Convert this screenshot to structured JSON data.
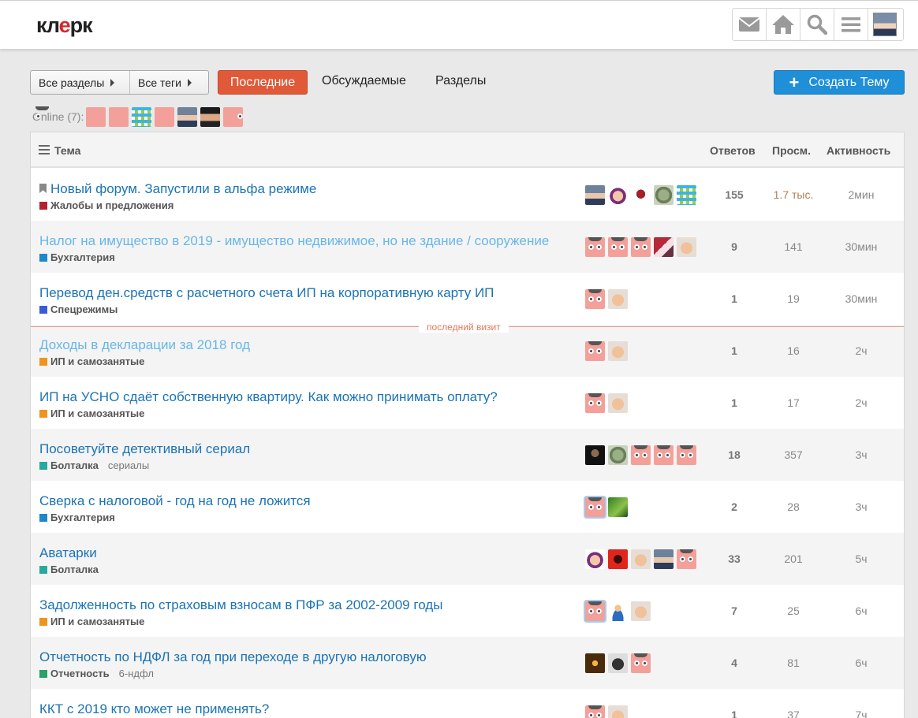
{
  "brand": {
    "logo_left": "кл",
    "logo_mid": "е",
    "logo_right": "рк"
  },
  "header_icons": [
    "mail-icon",
    "home-icon",
    "search-icon",
    "menu-icon",
    "user-avatar"
  ],
  "nav": {
    "all_sections": "Все разделы",
    "all_tags": "Все теги",
    "tab_latest": "Последние",
    "tab_discussed": "Обсуждаемые",
    "tab_sections": "Разделы",
    "create_topic": "Создать Тему"
  },
  "online": {
    "label": "Online (7):",
    "avatars": [
      "pig",
      "pig",
      "pix",
      "pig",
      "man",
      "dark",
      "pig"
    ]
  },
  "table": {
    "col_topic": "Тема",
    "col_replies": "Ответов",
    "col_views": "Просм.",
    "col_activity": "Активность",
    "last_visit_label": "последний визит"
  },
  "topics": [
    {
      "title": "Новый форум. Запустили в альфа режиме",
      "pinned": true,
      "visited": false,
      "category": "Жалобы и предложения",
      "cat_color": "#b3232f",
      "tag": "",
      "posters": [
        "man",
        "masha",
        "devil",
        "dollar",
        "pix"
      ],
      "replies": "155",
      "views": "1.7 тыс.",
      "activity": "2мин"
    },
    {
      "title": "Налог на имущество в 2019 - имущество недвижимое, но не здание / сооружение",
      "pinned": false,
      "visited": true,
      "category": "Бухгалтерия",
      "cat_color": "#1e88c8",
      "tag": "",
      "posters": [
        "pig",
        "pig",
        "pig",
        "anime",
        "cat"
      ],
      "replies": "9",
      "views": "141",
      "activity": "30мин"
    },
    {
      "title": "Перевод ден.средств с расчетного счета ИП на корпоративную карту ИП",
      "pinned": false,
      "visited": false,
      "category": "Спецрежимы",
      "cat_color": "#3a5bd9",
      "tag": "",
      "posters": [
        "pig",
        "cat"
      ],
      "replies": "1",
      "views": "19",
      "activity": "30мин"
    },
    {
      "title": "Доходы в декларации за 2018 год",
      "pinned": false,
      "visited": true,
      "category": "ИП и самозанятые",
      "cat_color": "#f0941e",
      "tag": "",
      "posters": [
        "pig",
        "cat"
      ],
      "replies": "1",
      "views": "16",
      "activity": "2ч"
    },
    {
      "title": "ИП на УСНО сдаёт собственную квартиру. Как можно принимать оплату?",
      "pinned": false,
      "visited": false,
      "category": "ИП и самозанятые",
      "cat_color": "#f0941e",
      "tag": "",
      "posters": [
        "pig",
        "cat"
      ],
      "replies": "1",
      "views": "17",
      "activity": "2ч"
    },
    {
      "title": "Посоветуйте детективный сериал",
      "pinned": false,
      "visited": false,
      "category": "Болталка",
      "cat_color": "#28a99e",
      "tag": "сериалы",
      "posters": [
        "black",
        "dollar",
        "pig",
        "pig",
        "pig"
      ],
      "replies": "18",
      "views": "357",
      "activity": "3ч"
    },
    {
      "title": "Сверка с налоговой - год на год не ложится",
      "pinned": false,
      "visited": false,
      "category": "Бухгалтерия",
      "cat_color": "#1e88c8",
      "tag": "",
      "posters": [
        "pig-hl",
        "leaf"
      ],
      "replies": "2",
      "views": "28",
      "activity": "3ч"
    },
    {
      "title": "Аватарки",
      "pinned": false,
      "visited": false,
      "category": "Болталка",
      "cat_color": "#28a99e",
      "tag": "",
      "posters": [
        "masha",
        "red",
        "cat",
        "man",
        "pig"
      ],
      "replies": "33",
      "views": "201",
      "activity": "5ч"
    },
    {
      "title": "Задолженность по страховым взносам в ПФР за 2002-2009 годы",
      "pinned": false,
      "visited": false,
      "category": "ИП и самозанятые",
      "cat_color": "#f0941e",
      "tag": "",
      "posters": [
        "pig-hl",
        "user",
        "cat"
      ],
      "replies": "7",
      "views": "25",
      "activity": "6ч"
    },
    {
      "title": "Отчетность по НДФЛ за год при переходе в другую налоговую",
      "pinned": false,
      "visited": false,
      "category": "Отчетность",
      "cat_color": "#2aa06a",
      "tag": "6-ндфл",
      "posters": [
        "gold",
        "wcat",
        "pig"
      ],
      "replies": "4",
      "views": "81",
      "activity": "6ч"
    },
    {
      "title": "ККТ с 2019 кто может не применять?",
      "pinned": false,
      "visited": false,
      "category": "",
      "cat_color": "#1e88c8",
      "tag": "",
      "posters": [
        "pig",
        "cat"
      ],
      "replies": "1",
      "views": "37",
      "activity": "7ч"
    }
  ]
}
